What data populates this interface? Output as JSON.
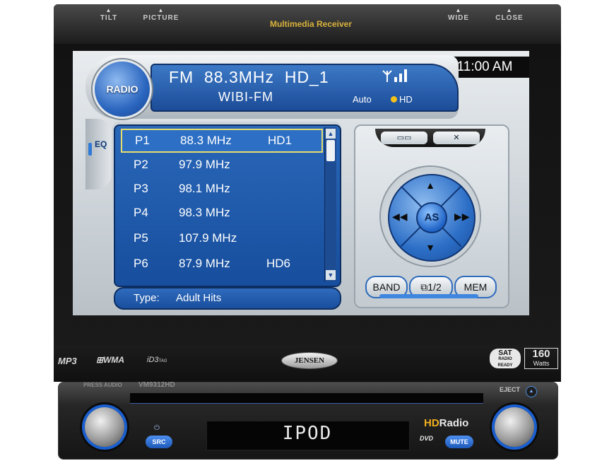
{
  "top_bar": {
    "tilt": "TILT",
    "picture": "PICTURE",
    "title": "Multimedia Receiver",
    "wide": "WIDE",
    "close": "CLOSE"
  },
  "screen": {
    "clock": "11:00  AM",
    "radio_button": "RADIO",
    "band": "FM",
    "frequency": "88.3MHz",
    "hd_channel": "HD_1",
    "station": "WIBI-FM",
    "mode": "Auto",
    "hd_label": "HD",
    "eq_label": "EQ",
    "presets": [
      {
        "p": "P1",
        "freq": "88.3  MHz",
        "hd": "HD1"
      },
      {
        "p": "P2",
        "freq": "97.9  MHz",
        "hd": ""
      },
      {
        "p": "P3",
        "freq": "98.1  MHz",
        "hd": ""
      },
      {
        "p": "P4",
        "freq": "98.3  MHz",
        "hd": ""
      },
      {
        "p": "P5",
        "freq": "107.9 MHz",
        "hd": ""
      },
      {
        "p": "P6",
        "freq": "87.9  MHz",
        "hd": "HD6"
      }
    ],
    "type_label": "Type:",
    "type_value": "Adult Hits",
    "as_button": "AS",
    "band_button": "BAND",
    "page_button": "1/2",
    "mem_button": "MEM"
  },
  "bezel": {
    "mp3": "MP3",
    "wma": "WMA",
    "id3": "iD3",
    "id3_tag": "TAG",
    "brand": "JENSEN",
    "sat_top": "SAT",
    "sat_mid": "RADIO",
    "sat_bottom": "READY",
    "watts_num": "160",
    "watts_unit": "Watts"
  },
  "faceplate": {
    "press_audio": "PRESS AUDIO",
    "model": "VM9312HD",
    "eject": "EJECT",
    "display": "IPOD",
    "src": "SRC",
    "mute": "MUTE",
    "hd_radio_hd": "HD",
    "hd_radio_txt": "Radio",
    "dvd": "DVD"
  },
  "colors": {
    "screen_blue": "#1c4c98",
    "accent_yellow": "#e5dd6e",
    "title_gold": "#d8b23a",
    "knob_ring": "#1a5fd0"
  }
}
